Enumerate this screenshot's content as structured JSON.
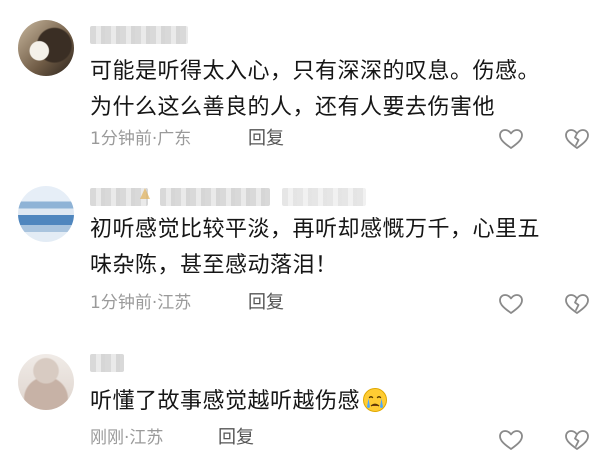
{
  "comments": [
    {
      "text_line1": "可能是听得太入心，只有深深的叹息。伤感。",
      "text_line2": "为什么这么善良的人，还有人要去伤害他",
      "time": "1分钟前",
      "location": "广东",
      "meta_separator": "·",
      "reply_label": "回复"
    },
    {
      "text_line1": "初听感觉比较平淡，再听却感慨万千，心里五",
      "text_line2": "味杂陈，甚至感动落泪！",
      "time": "1分钟前",
      "location": "江苏",
      "meta_separator": "·",
      "reply_label": "回复"
    },
    {
      "text": "听懂了故事感觉越听越伤感",
      "emoji_icon": "crying-face-icon",
      "time": "刚刚",
      "location": "江苏",
      "meta_separator": "·",
      "reply_label": "回复"
    }
  ],
  "icons": {
    "like": "heart-outline-icon",
    "dislike": "broken-heart-icon"
  },
  "colors": {
    "text": "#161616",
    "meta": "#9a9a9a",
    "reply": "#555555",
    "icon": "#8a8a8a"
  }
}
